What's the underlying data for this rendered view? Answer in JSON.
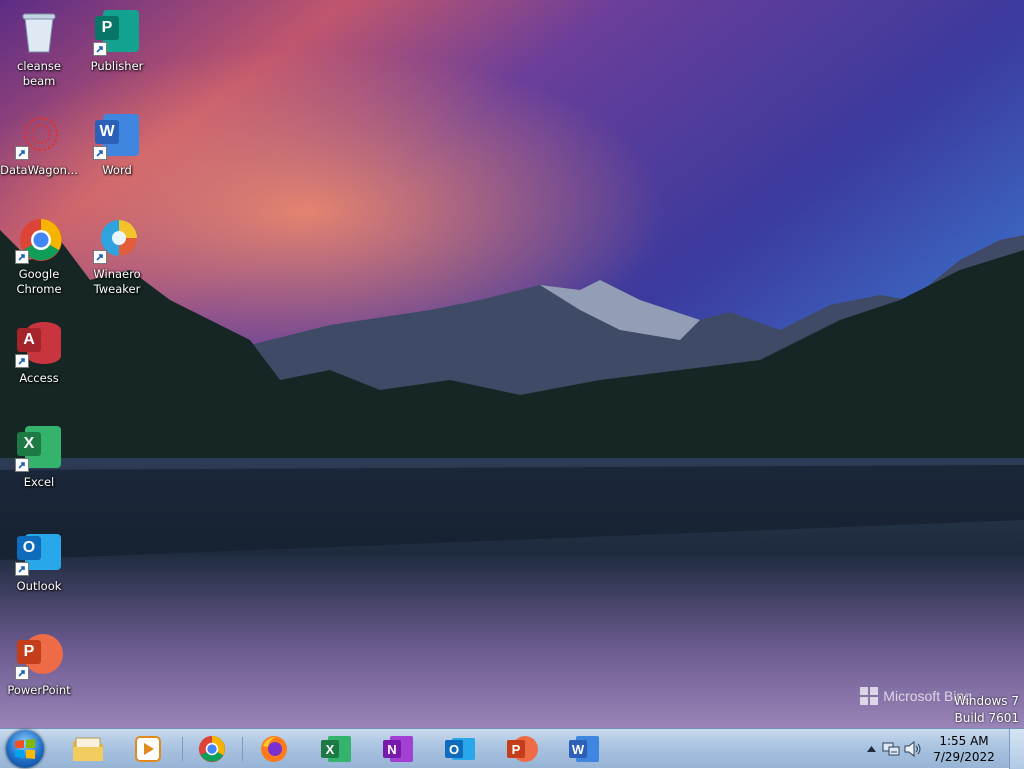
{
  "desktop": {
    "icons": [
      {
        "label": "cleanse beam",
        "icon": "recycle-bin-icon"
      },
      {
        "label": "Publisher",
        "icon": "publisher-icon"
      },
      {
        "label": "DataWagon...",
        "icon": "datawagon-icon"
      },
      {
        "label": "Word",
        "icon": "word-icon"
      },
      {
        "label": "Google Chrome",
        "icon": "chrome-icon"
      },
      {
        "label": "Winaero Tweaker",
        "icon": "winaero-tweaker-icon"
      },
      {
        "label": "Access",
        "icon": "access-icon"
      },
      {
        "label": "Excel",
        "icon": "excel-icon"
      },
      {
        "label": "Outlook",
        "icon": "outlook-icon"
      },
      {
        "label": "PowerPoint",
        "icon": "powerpoint-icon"
      }
    ],
    "watermark": {
      "brand": "Microsoft Bing",
      "os": "Windows 7",
      "build": "Build 7601"
    }
  },
  "taskbar": {
    "pinned": [
      {
        "name": "File Explorer",
        "icon": "file-explorer-icon"
      },
      {
        "name": "Windows Media Player",
        "icon": "media-player-icon"
      },
      {
        "name": "Google Chrome",
        "icon": "chrome-icon"
      },
      {
        "name": "Firefox",
        "icon": "firefox-icon"
      },
      {
        "name": "Excel",
        "icon": "excel-icon"
      },
      {
        "name": "OneNote",
        "icon": "onenote-icon"
      },
      {
        "name": "Outlook",
        "icon": "outlook-icon"
      },
      {
        "name": "PowerPoint",
        "icon": "powerpoint-icon"
      },
      {
        "name": "Word",
        "icon": "word-icon"
      }
    ],
    "clock": {
      "time": "1:55 AM",
      "date": "7/29/2022"
    }
  },
  "colors": {
    "word": "#2b5fb8",
    "excel": "#1e7a45",
    "powerpoint": "#c43e1c",
    "outlook": "#0f6cbd",
    "access": "#a4262c",
    "publisher": "#077568",
    "onenote": "#7719aa"
  }
}
